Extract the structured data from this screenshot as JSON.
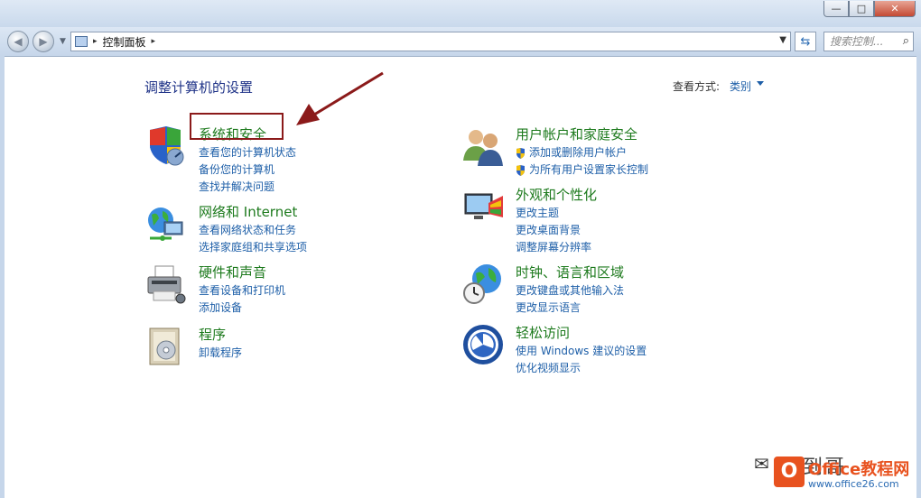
{
  "window": {
    "min": "—",
    "max": "□",
    "close": "✕"
  },
  "address": {
    "sep1": "▸",
    "path": "控制面板",
    "sep2": "▸"
  },
  "search": {
    "placeholder": "搜索控制..."
  },
  "page": {
    "title": "调整计算机的设置",
    "view_by_label": "查看方式:",
    "view_by_value": "类别"
  },
  "categories": [
    {
      "title": "系统和安全",
      "links": [
        "查看您的计算机状态",
        "备份您的计算机",
        "查找并解决问题"
      ]
    },
    {
      "title": "网络和 Internet",
      "links": [
        "查看网络状态和任务",
        "选择家庭组和共享选项"
      ]
    },
    {
      "title": "硬件和声音",
      "links": [
        "查看设备和打印机",
        "添加设备"
      ]
    },
    {
      "title": "程序",
      "links": [
        "卸载程序"
      ]
    },
    {
      "title": "用户帐户和家庭安全",
      "links": [
        "添加或删除用户帐户",
        "为所有用户设置家长控制"
      ]
    },
    {
      "title": "外观和个性化",
      "links": [
        "更改主题",
        "更改桌面背景",
        "调整屏幕分辨率"
      ]
    },
    {
      "title": "时钟、语言和区域",
      "links": [
        "更改键盘或其他输入法",
        "更改显示语言"
      ]
    },
    {
      "title": "轻松访问",
      "links": [
        "使用 Windows 建议的设置",
        "优化视频显示"
      ]
    }
  ],
  "watermark": {
    "name": "即到哥",
    "logo": "O",
    "brand": "Office教程网",
    "url": "www.office26.com"
  },
  "colors": {
    "title_green": "#1d7a1d",
    "link_blue": "#1e5fa8",
    "heading_blue": "#1e3287",
    "highlight": "#8b1a1a",
    "brand_orange": "#e8521f"
  }
}
